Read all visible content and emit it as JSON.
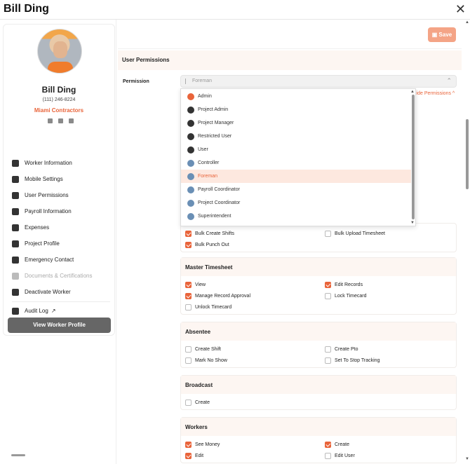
{
  "header": {
    "title": "Bill Ding",
    "close_symbol": "✕"
  },
  "profile": {
    "name": "Bill Ding",
    "phone": "(111) 246-8224",
    "company": "Miami Contractors",
    "menu": [
      {
        "label": "Worker Information",
        "icon": "id-card-icon"
      },
      {
        "label": "Mobile Settings",
        "icon": "gear-icon"
      },
      {
        "label": "User Permissions",
        "icon": "user-icon"
      },
      {
        "label": "Payroll Information",
        "icon": "dollar-icon"
      },
      {
        "label": "Expenses",
        "icon": "dollar-icon"
      },
      {
        "label": "Project Profile",
        "icon": "building-icon"
      },
      {
        "label": "Emergency Contact",
        "icon": "contact-card-icon"
      },
      {
        "label": "Documents & Certifications",
        "icon": "document-icon",
        "disabled": true
      },
      {
        "label": "Deactivate Worker",
        "icon": "trash-icon"
      },
      {
        "label": "Audit Log",
        "icon": "search-icon",
        "external": "↗"
      }
    ],
    "view_button": "View Worker Profile"
  },
  "main": {
    "save_label": "Save",
    "section_title": "User Permissions",
    "permission_label": "Permission",
    "permission_value": "Foreman",
    "hide_link": "lide Permissions ^",
    "dropdown_options": [
      {
        "label": "Admin",
        "icon_color": "#e9643a"
      },
      {
        "label": "Project Admin",
        "icon_color": "#333"
      },
      {
        "label": "Project Manager",
        "icon_color": "#333"
      },
      {
        "label": "Restricted User",
        "icon_color": "#333"
      },
      {
        "label": "User",
        "icon_color": "#333"
      },
      {
        "label": "Controller",
        "icon_color": "#6a8fb5"
      },
      {
        "label": "Foreman",
        "icon_color": "#6a8fb5",
        "selected": true
      },
      {
        "label": "Payroll Coordinator",
        "icon_color": "#6a8fb5"
      },
      {
        "label": "Project Coordinator",
        "icon_color": "#6a8fb5"
      },
      {
        "label": "Superintendent",
        "icon_color": "#6a8fb5"
      }
    ],
    "partial_checks": [
      {
        "label": "Bulk Create Shifts",
        "checked": true
      },
      {
        "label": "Bulk Upload Timesheet",
        "checked": false
      },
      {
        "label": "Bulk Punch Out",
        "checked": true
      }
    ],
    "sections": [
      {
        "title": "Master Timesheet",
        "items": [
          {
            "label": "View",
            "checked": true
          },
          {
            "label": "Edit Records",
            "checked": true
          },
          {
            "label": "Manage Record Approval",
            "checked": true
          },
          {
            "label": "Lock Timecard",
            "checked": false
          },
          {
            "label": "Unlock Timecard",
            "checked": false
          }
        ]
      },
      {
        "title": "Absentee",
        "items": [
          {
            "label": "Create Shift",
            "checked": false
          },
          {
            "label": "Create Pto",
            "checked": false
          },
          {
            "label": "Mark No Show",
            "checked": false
          },
          {
            "label": "Set To Stop Tracking",
            "checked": false
          }
        ]
      },
      {
        "title": "Broadcast",
        "items": [
          {
            "label": "Create",
            "checked": false
          }
        ]
      },
      {
        "title": "Workers",
        "items": [
          {
            "label": "See Money",
            "checked": true
          },
          {
            "label": "Create",
            "checked": true
          },
          {
            "label": "Edit",
            "checked": true
          },
          {
            "label": "Edit User",
            "checked": false
          }
        ]
      }
    ]
  },
  "colors": {
    "accent": "#e9643a",
    "accent_light": "#f4a486"
  }
}
